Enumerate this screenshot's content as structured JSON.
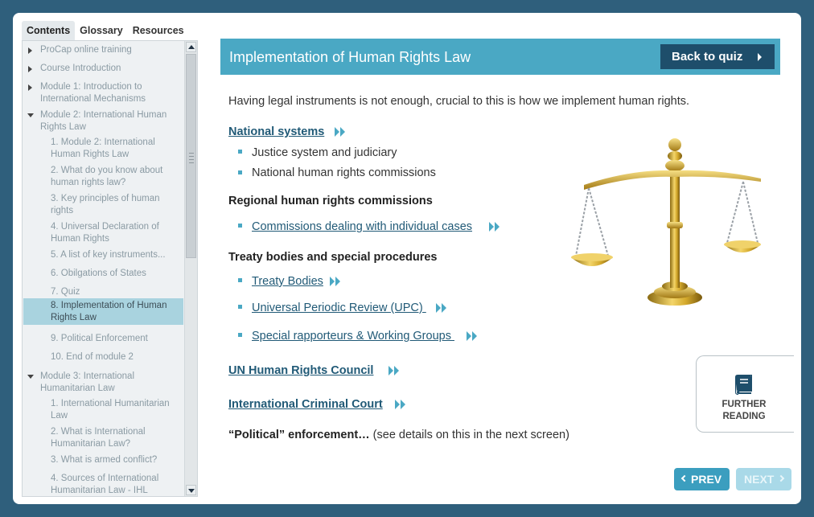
{
  "sidebar": {
    "tabs": [
      {
        "label": "Contents",
        "active": true
      },
      {
        "label": "Glossary",
        "active": false
      },
      {
        "label": "Resources",
        "active": false
      }
    ],
    "toc": [
      {
        "label": "ProCap online training",
        "level": 1,
        "expander": "collapsed",
        "active": false
      },
      {
        "label": "Course Introduction",
        "level": 1,
        "expander": "collapsed",
        "active": false
      },
      {
        "label": "Module 1: Introduction to International Mechanisms",
        "level": 1,
        "expander": "collapsed",
        "active": false
      },
      {
        "label": "Module 2: International Human Rights Law",
        "level": 1,
        "expander": "expanded",
        "active": false
      },
      {
        "label": "1. Module 2: International Human Rights Law",
        "level": 2,
        "active": false
      },
      {
        "label": "2. What do you know about human rights law?",
        "level": 2,
        "active": false
      },
      {
        "label": "3. Key principles of human rights",
        "level": 2,
        "active": false
      },
      {
        "label": "4. Universal Declaration of Human Rights",
        "level": 2,
        "active": false
      },
      {
        "label": "5. A list of key instruments...",
        "level": 2,
        "active": false
      },
      {
        "label": "6. Obilgations of States",
        "level": 2,
        "active": false
      },
      {
        "label": "7. Quiz",
        "level": 2,
        "active": false
      },
      {
        "label": "8. Implementation of Human Rights Law",
        "level": 2,
        "active": true
      },
      {
        "label": "9. Political Enforcement",
        "level": 2,
        "active": false
      },
      {
        "label": "10. End of module 2",
        "level": 2,
        "active": false
      },
      {
        "label": "Module 3: International Humanitarian Law",
        "level": 1,
        "expander": "expanded",
        "active": false
      },
      {
        "label": "1. International Humanitarian Law",
        "level": 2,
        "active": false
      },
      {
        "label": "2. What is International Humanitarian Law?",
        "level": 2,
        "active": false
      },
      {
        "label": "3. What is armed conflict?",
        "level": 2,
        "active": false
      },
      {
        "label": "4. Sources of International Humanitarian Law - IHL",
        "level": 2,
        "active": false
      }
    ]
  },
  "header": {
    "title": "Implementation of Human Rights Law",
    "back_label": "Back to quiz"
  },
  "content": {
    "intro": "Having legal instruments is not enough, crucial to this is how we implement human rights.",
    "national_systems": "National systems",
    "national_items": [
      "Justice system and judiciary",
      "National human rights commissions"
    ],
    "regional_heading": "Regional human rights commissions",
    "regional_link": "Commissions dealing with individual cases",
    "treaty_heading": "Treaty bodies and special procedures",
    "treaty_links": [
      "Treaty Bodies",
      "Universal Periodic Review (UPC) ",
      "Special rapporteurs & Working Groups "
    ],
    "unhrc": "UN Human Rights Council",
    "icc": "International Criminal Court",
    "political_bold": "“Political” enforcement…",
    "political_rest": " (see details on this in the next screen)"
  },
  "further_reading": {
    "line1": "FURTHER",
    "line2": "READING",
    "icon": "book-icon"
  },
  "nav": {
    "prev_label": "PREV",
    "next_label": "NEXT",
    "next_enabled": false
  },
  "colors": {
    "accent": "#4aa8c4",
    "dark": "#1e4e6b",
    "frame_bg": "#2f5f7c",
    "active_toc": "#a9d3df"
  }
}
